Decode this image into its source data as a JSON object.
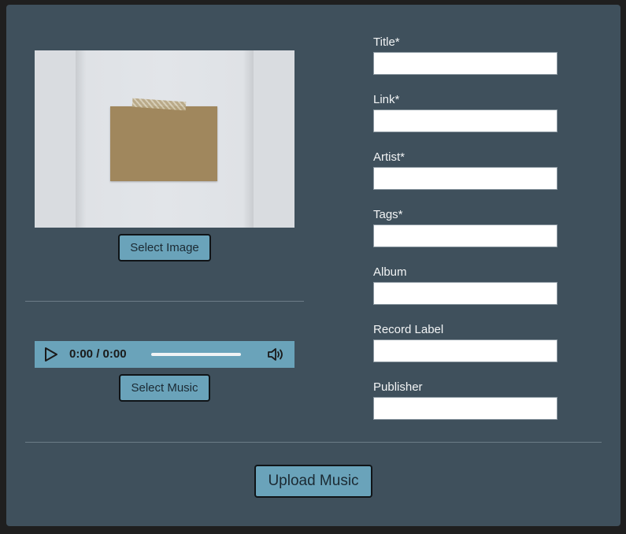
{
  "image_section": {
    "select_image_label": "Select Image"
  },
  "music_section": {
    "select_music_label": "Select Music",
    "player": {
      "time_display": "0:00 / 0:00",
      "progress": 0
    }
  },
  "form": {
    "fields": [
      {
        "label": "Title*",
        "value": "",
        "placeholder": ""
      },
      {
        "label": "Link*",
        "value": "",
        "placeholder": ""
      },
      {
        "label": "Artist*",
        "value": "",
        "placeholder": ""
      },
      {
        "label": "Tags*",
        "value": "",
        "placeholder": ""
      },
      {
        "label": "Album",
        "value": "",
        "placeholder": ""
      },
      {
        "label": "Record Label",
        "value": "",
        "placeholder": ""
      },
      {
        "label": "Publisher",
        "value": "",
        "placeholder": ""
      }
    ]
  },
  "actions": {
    "upload_label": "Upload Music"
  },
  "colors": {
    "panel_bg": "#3f505c",
    "accent": "#6aa3ba",
    "page_bg": "#1f1f1f"
  },
  "icons": {
    "play": "play-icon",
    "volume": "volume-icon"
  }
}
